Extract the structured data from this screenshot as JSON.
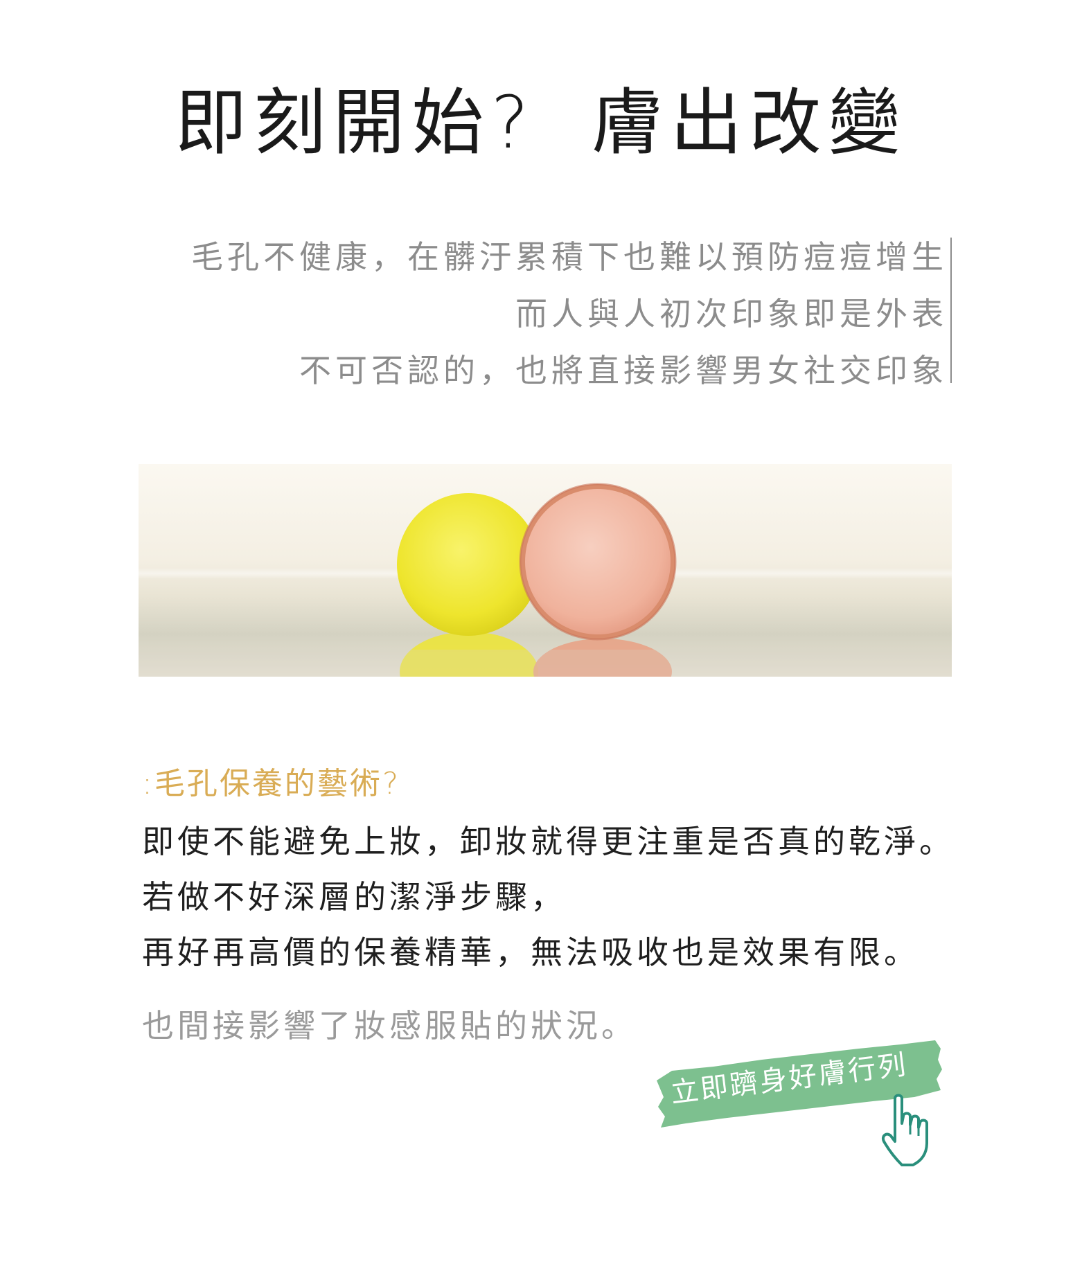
{
  "header": {
    "title_part1": "即刻開始?",
    "title_part2": "膚出改變"
  },
  "intro": {
    "lines": [
      "毛孔不健康，在髒汙累積下也難以預防痘痘增生",
      "而人與人初次印象即是外表",
      "不可否認的，也將直接影響男女社交印象"
    ]
  },
  "section": {
    "title": ":毛孔保養的藝術?",
    "body_lines": [
      "即使不能避免上妝，卸妝就得更注重是否真的乾淨。",
      "若做不好深層的潔淨步驟，",
      "再好再高價的保養精華，無法吸收也是效果有限。"
    ],
    "note": "也間接影響了妝感服貼的狀況。"
  },
  "cta": {
    "label": "立即躋身好膚行列",
    "color": "#7dc08f",
    "icon": "pointer-hand-icon",
    "icon_color": "#2a8f7c"
  },
  "hero_image": {
    "icon": "soap-bars-photo",
    "colors": {
      "yellow": "#f2ea3a",
      "pink": "#f2b8a4"
    }
  }
}
